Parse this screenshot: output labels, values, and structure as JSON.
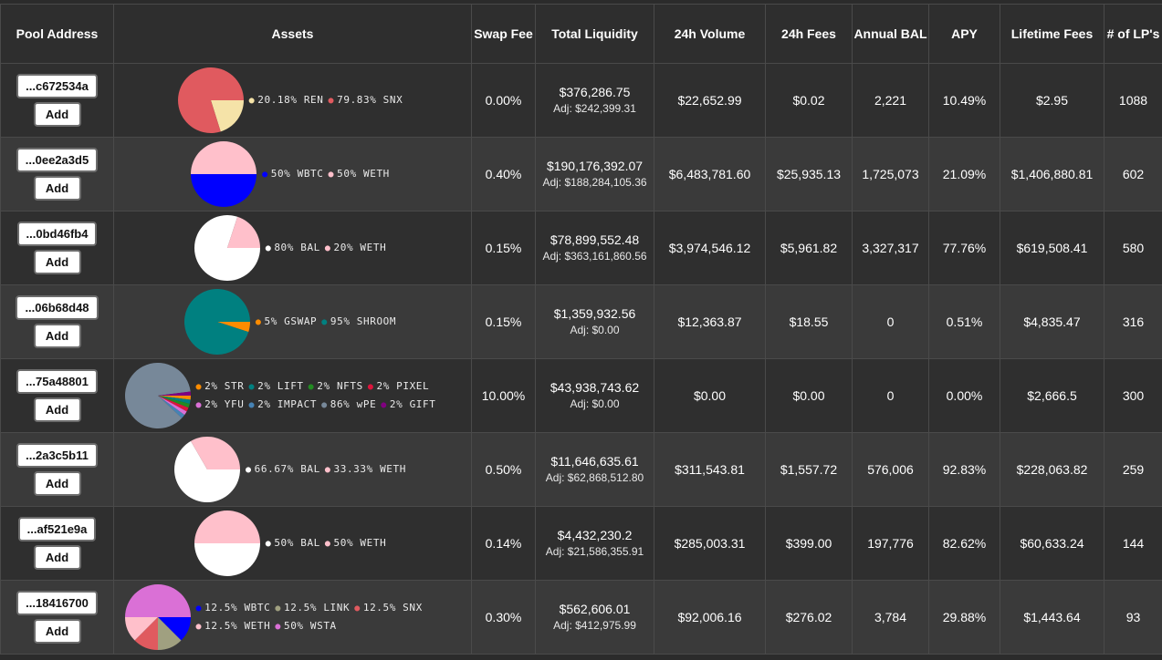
{
  "headers": {
    "pool_address": "Pool Address",
    "assets": "Assets",
    "swap_fee": "Swap Fee",
    "total_liquidity": "Total Liquidity",
    "volume_24h": "24h Volume",
    "fees_24h": "24h Fees",
    "annual_bal": "Annual BAL",
    "apy": "APY",
    "lifetime_fees": "Lifetime Fees",
    "lps": "# of LP's"
  },
  "add_label": "Add",
  "rows": [
    {
      "address": "...c672534a",
      "assets": [
        {
          "pct": 20.18,
          "label": "20.18% REN",
          "color": "#f5e3a8"
        },
        {
          "pct": 79.83,
          "label": "79.83% SNX",
          "color": "#e05a5f"
        }
      ],
      "swap_fee": "0.00%",
      "liquidity": "$376,286.75",
      "adj": "Adj: $242,399.31",
      "volume": "$22,652.99",
      "fees": "$0.02",
      "annual_bal": "2,221",
      "apy": "10.49%",
      "lifetime": "$2.95",
      "lps": "1088"
    },
    {
      "address": "...0ee2a3d5",
      "assets": [
        {
          "pct": 50,
          "label": "50% WBTC",
          "color": "#0000ff"
        },
        {
          "pct": 50,
          "label": "50% WETH",
          "color": "#ffc0cb"
        }
      ],
      "swap_fee": "0.40%",
      "liquidity": "$190,176,392.07",
      "adj": "Adj: $188,284,105.36",
      "volume": "$6,483,781.60",
      "fees": "$25,935.13",
      "annual_bal": "1,725,073",
      "apy": "21.09%",
      "lifetime": "$1,406,880.81",
      "lps": "602"
    },
    {
      "address": "...0bd46fb4",
      "assets": [
        {
          "pct": 80,
          "label": "80% BAL",
          "color": "#ffffff"
        },
        {
          "pct": 20,
          "label": "20% WETH",
          "color": "#ffc0cb"
        }
      ],
      "swap_fee": "0.15%",
      "liquidity": "$78,899,552.48",
      "adj": "Adj: $363,161,860.56",
      "volume": "$3,974,546.12",
      "fees": "$5,961.82",
      "annual_bal": "3,327,317",
      "apy": "77.76%",
      "lifetime": "$619,508.41",
      "lps": "580"
    },
    {
      "address": "...06b68d48",
      "assets": [
        {
          "pct": 5,
          "label": "5% GSWAP",
          "color": "#ff8c00"
        },
        {
          "pct": 95,
          "label": "95% SHROOM",
          "color": "#008080"
        }
      ],
      "swap_fee": "0.15%",
      "liquidity": "$1,359,932.56",
      "adj": "Adj: $0.00",
      "volume": "$12,363.87",
      "fees": "$18.55",
      "annual_bal": "0",
      "apy": "0.51%",
      "lifetime": "$4,835.47",
      "lps": "316"
    },
    {
      "address": "...75a48801",
      "assets": [
        {
          "pct": 2,
          "label": "2% STR",
          "color": "#ff8c00"
        },
        {
          "pct": 2,
          "label": "2% LIFT",
          "color": "#008080"
        },
        {
          "pct": 2,
          "label": "2% NFTS",
          "color": "#228b22"
        },
        {
          "pct": 2,
          "label": "2% PIXEL",
          "color": "#dc143c"
        },
        {
          "pct": 2,
          "label": "2% YFU",
          "color": "#da70d6"
        },
        {
          "pct": 2,
          "label": "2% IMPACT",
          "color": "#4682b4"
        },
        {
          "pct": 86,
          "label": "86% wPE",
          "color": "#778899"
        },
        {
          "pct": 2,
          "label": "2% GIFT",
          "color": "#800080"
        }
      ],
      "swap_fee": "10.00%",
      "liquidity": "$43,938,743.62",
      "adj": "Adj: $0.00",
      "volume": "$0.00",
      "fees": "$0.00",
      "annual_bal": "0",
      "apy": "0.00%",
      "lifetime": "$2,666.5",
      "lps": "300"
    },
    {
      "address": "...2a3c5b11",
      "assets": [
        {
          "pct": 66.67,
          "label": "66.67% BAL",
          "color": "#ffffff"
        },
        {
          "pct": 33.33,
          "label": "33.33% WETH",
          "color": "#ffc0cb"
        }
      ],
      "swap_fee": "0.50%",
      "liquidity": "$11,646,635.61",
      "adj": "Adj: $62,868,512.80",
      "volume": "$311,543.81",
      "fees": "$1,557.72",
      "annual_bal": "576,006",
      "apy": "92.83%",
      "lifetime": "$228,063.82",
      "lps": "259"
    },
    {
      "address": "...af521e9a",
      "assets": [
        {
          "pct": 50,
          "label": "50% BAL",
          "color": "#ffffff"
        },
        {
          "pct": 50,
          "label": "50% WETH",
          "color": "#ffc0cb"
        }
      ],
      "swap_fee": "0.14%",
      "liquidity": "$4,432,230.2",
      "adj": "Adj: $21,586,355.91",
      "volume": "$285,003.31",
      "fees": "$399.00",
      "annual_bal": "197,776",
      "apy": "82.62%",
      "lifetime": "$60,633.24",
      "lps": "144"
    },
    {
      "address": "...18416700",
      "assets": [
        {
          "pct": 12.5,
          "label": "12.5% WBTC",
          "color": "#0000ff"
        },
        {
          "pct": 12.5,
          "label": "12.5% LINK",
          "color": "#a0a080"
        },
        {
          "pct": 12.5,
          "label": "12.5% SNX",
          "color": "#e05a5f"
        },
        {
          "pct": 12.5,
          "label": "12.5% WETH",
          "color": "#ffc0cb"
        },
        {
          "pct": 50,
          "label": "50% WSTA",
          "color": "#da70d6"
        }
      ],
      "swap_fee": "0.30%",
      "liquidity": "$562,606.01",
      "adj": "Adj: $412,975.99",
      "volume": "$92,006.16",
      "fees": "$276.02",
      "annual_bal": "3,784",
      "apy": "29.88%",
      "lifetime": "$1,443.64",
      "lps": "93"
    }
  ]
}
